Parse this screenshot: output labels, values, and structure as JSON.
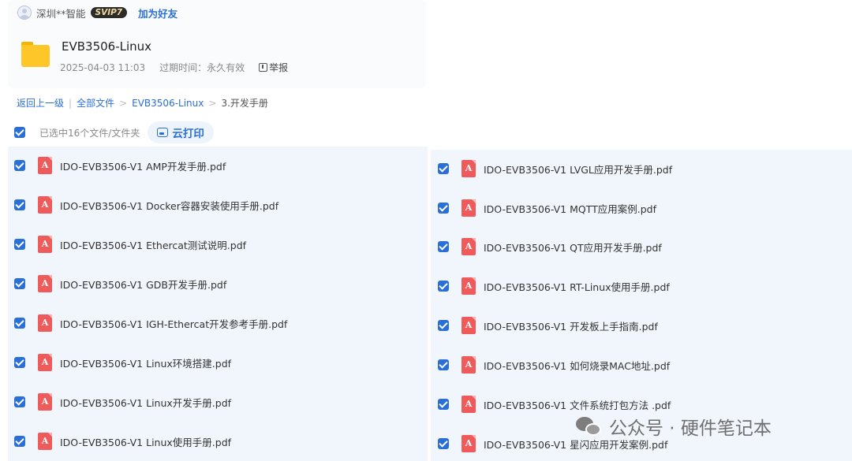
{
  "owner": {
    "name": "深圳**智能",
    "badge": "SVIP7",
    "add_friend_label": "加为好友"
  },
  "folder": {
    "name": "EVB3506-Linux",
    "date": "2025-04-03 11:03",
    "expire": "过期时间：永久有效",
    "report_label": "举报"
  },
  "breadcrumb": {
    "back": "返回上一级",
    "sep1": "|",
    "all_files": "全部文件",
    "sep2": ">",
    "parent": "EVB3506-Linux",
    "sep3": ">",
    "current": "3.开发手册"
  },
  "selection": {
    "count_text": "已选中16个文件/文件夹",
    "cloud_print_label": "云打印"
  },
  "files_left": [
    "IDO-EVB3506-V1 AMP开发手册.pdf",
    "IDO-EVB3506-V1 Docker容器安装使用手册.pdf",
    "IDO-EVB3506-V1 Ethercat测试说明.pdf",
    "IDO-EVB3506-V1 GDB开发手册.pdf",
    "IDO-EVB3506-V1 IGH-Ethercat开发参考手册.pdf",
    "IDO-EVB3506-V1 Linux环境搭建.pdf",
    "IDO-EVB3506-V1 Linux开发手册.pdf",
    "IDO-EVB3506-V1 Linux使用手册.pdf"
  ],
  "files_right": [
    "IDO-EVB3506-V1 LVGL应用开发手册.pdf",
    "IDO-EVB3506-V1 MQTT应用案例.pdf",
    "IDO-EVB3506-V1 QT应用开发手册.pdf",
    "IDO-EVB3506-V1 RT-Linux使用手册.pdf",
    "IDO-EVB3506-V1 开发板上手指南.pdf",
    "IDO-EVB3506-V1 如何烧录MAC地址.pdf",
    "IDO-EVB3506-V1 文件系统打包方法 .pdf",
    "IDO-EVB3506-V1 星闪应用开发案例.pdf"
  ],
  "pdf_glyph": "A",
  "watermark": "公众号 · 硬件笔记本",
  "colors": {
    "accent": "#2a6fd8",
    "pdf_red": "#ef5b5b",
    "panel_bg": "#f1f6fd"
  }
}
